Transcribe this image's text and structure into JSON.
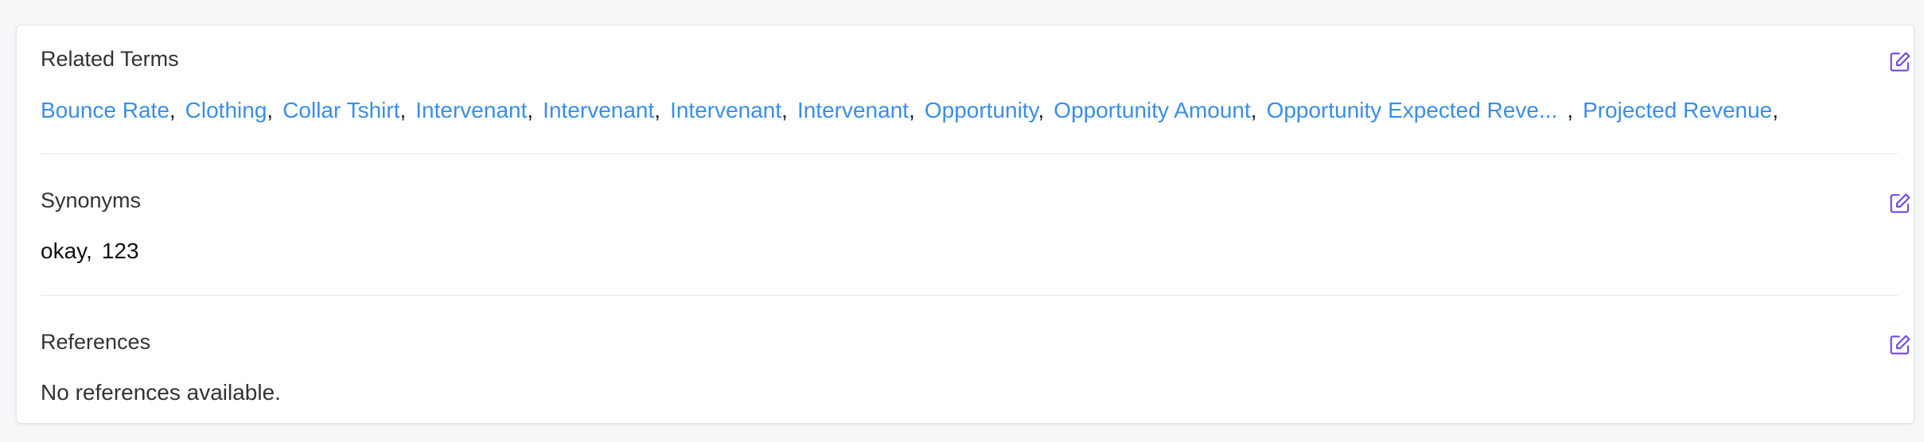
{
  "related_terms": {
    "title": "Related Terms",
    "edit_icon": "edit-icon",
    "items": [
      "Bounce Rate",
      "Clothing",
      "Collar Tshirt",
      "Intervenant",
      "Intervenant",
      "Intervenant",
      "Intervenant",
      "Opportunity",
      "Opportunity Amount",
      "Opportunity Expected Reve...",
      "Projected Revenue"
    ],
    "separator": ","
  },
  "synonyms": {
    "title": "Synonyms",
    "edit_icon": "edit-icon",
    "items": [
      "okay",
      "123"
    ],
    "separator": ","
  },
  "references": {
    "title": "References",
    "edit_icon": "edit-icon",
    "empty_text": "No references available."
  },
  "colors": {
    "link": "#3a8ee6",
    "edit_icon": "#7147e8"
  }
}
